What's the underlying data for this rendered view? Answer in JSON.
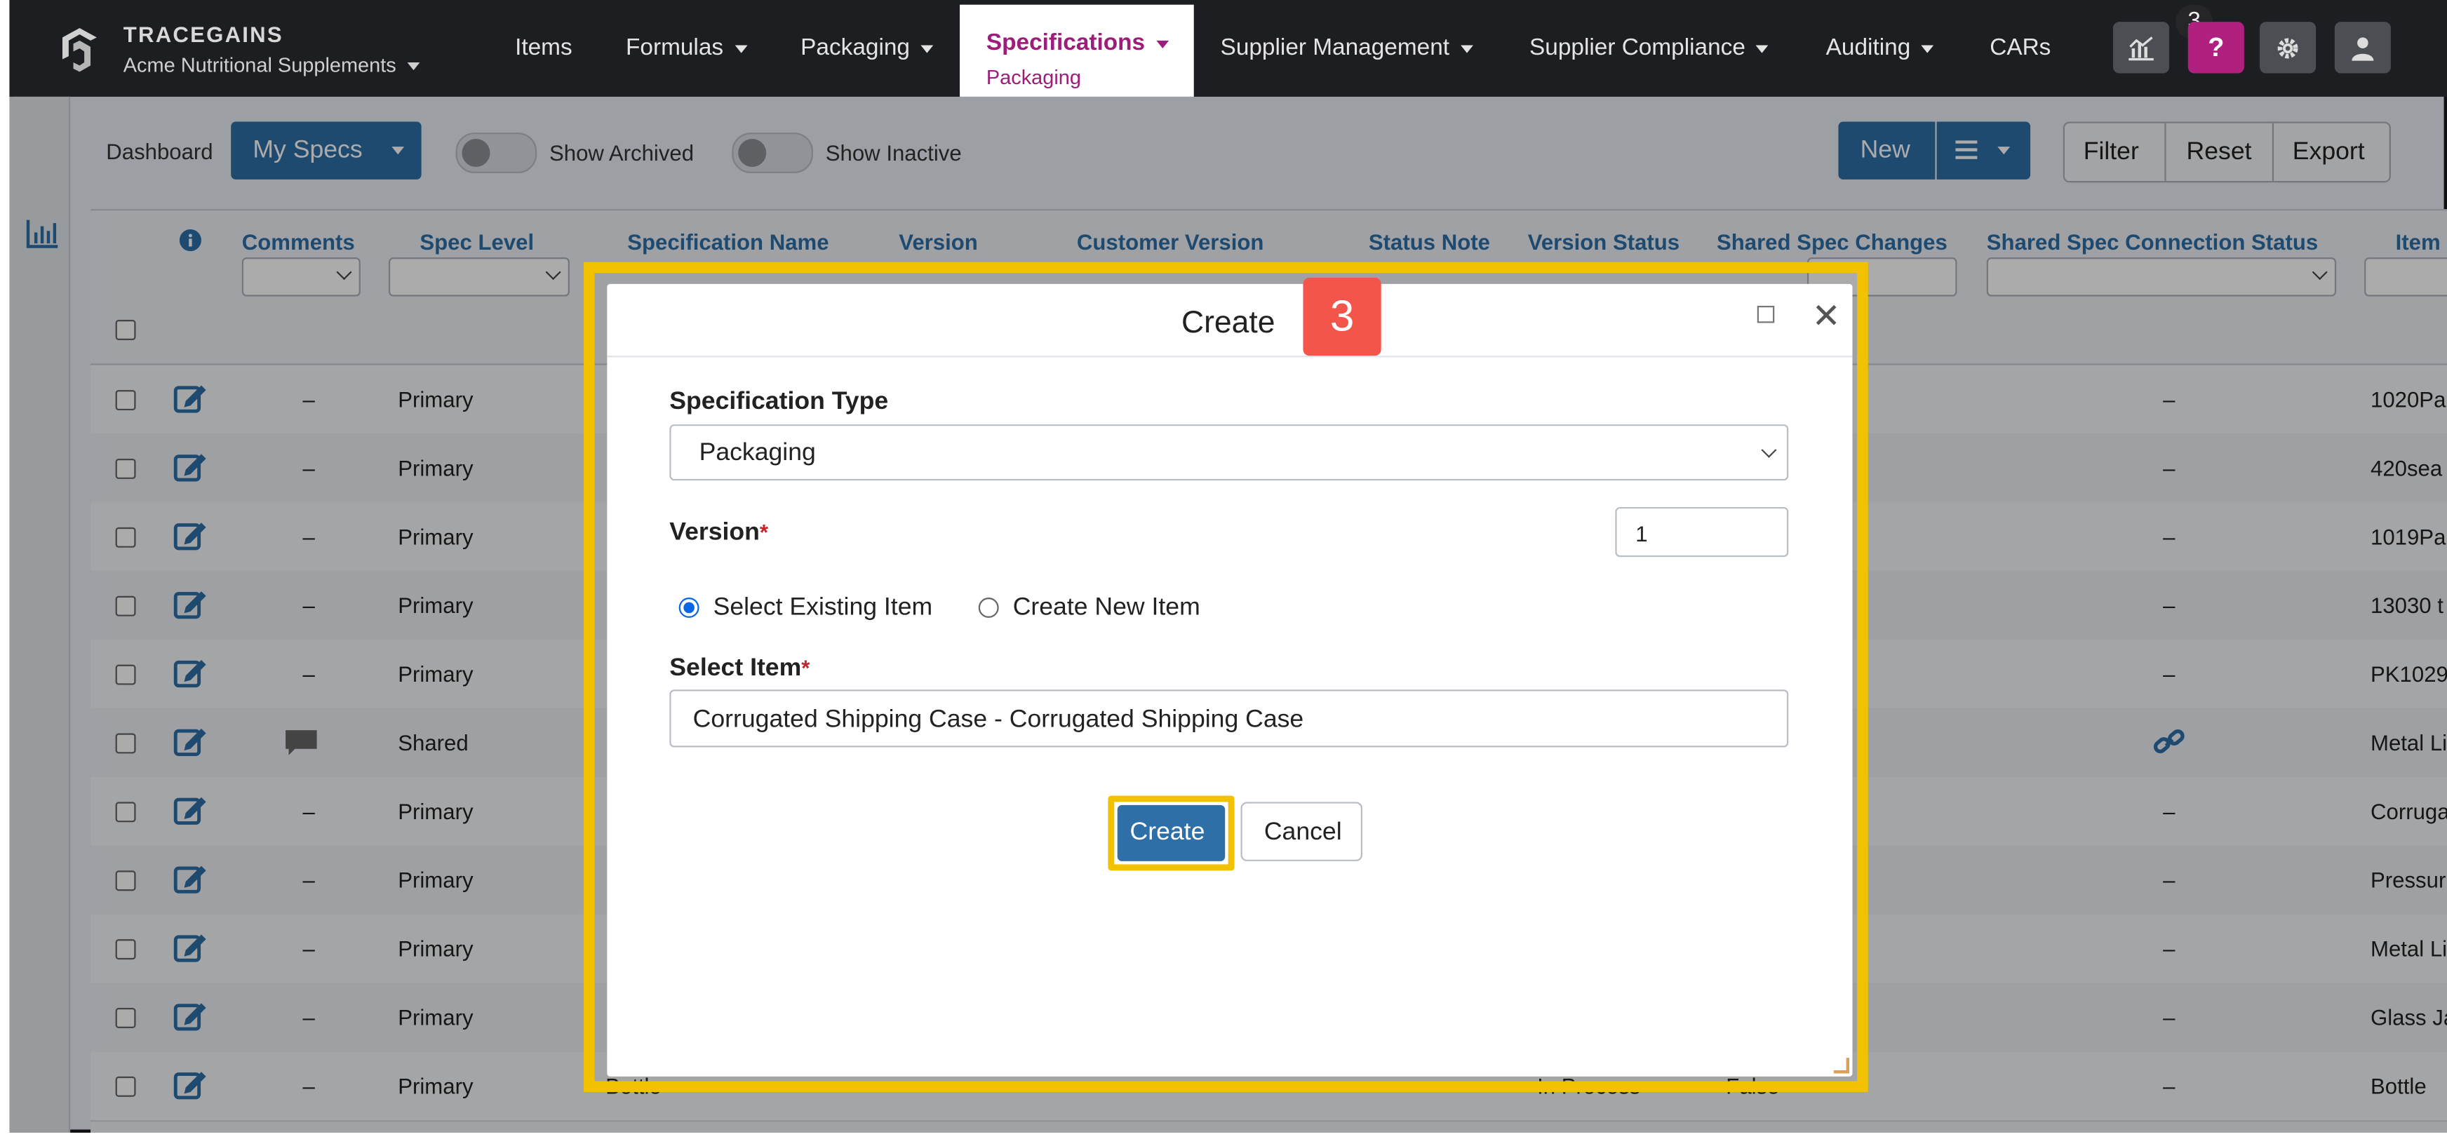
{
  "app": {
    "brand": "TRACEGAINS",
    "org": "Acme Nutritional Supplements",
    "nav": [
      {
        "label": "Items",
        "dropdown": false
      },
      {
        "label": "Formulas",
        "dropdown": true
      },
      {
        "label": "Packaging",
        "dropdown": true
      },
      {
        "label": "Supplier Management",
        "dropdown": true
      },
      {
        "label": "Supplier Compliance",
        "dropdown": true
      },
      {
        "label": "Auditing",
        "dropdown": true
      },
      {
        "label": "CARs",
        "dropdown": false
      }
    ],
    "active_nav": {
      "label": "Specifications",
      "sublabel": "Packaging"
    },
    "notif_count": "3",
    "help_label": "?",
    "icons": {
      "analytics": "chart-icon",
      "help": "question-icon",
      "settings": "gear-icon",
      "user": "user-icon"
    }
  },
  "toolbar": {
    "dashboard": "Dashboard",
    "my_specs": "My Specs",
    "show_archived": "Show Archived",
    "show_inactive": "Show Inactive",
    "new": "New",
    "filter": "Filter",
    "reset": "Reset",
    "export": "Export"
  },
  "table": {
    "headers": {
      "comments": "Comments",
      "spec_level": "Spec Level",
      "spec_name": "Specification Name",
      "version": "Version",
      "customer_version": "Customer Version",
      "status_note": "Status Note",
      "version_status": "Version Status",
      "shared_spec_changes": "Shared Spec Changes",
      "shared_spec_connection_status": "Shared Spec Connection Status",
      "item": "Item"
    },
    "rows": [
      {
        "comments": "–",
        "level": "Primary",
        "conn": "–",
        "item": "1020Pa"
      },
      {
        "comments": "–",
        "level": "Primary",
        "conn": "–",
        "item": "420sea"
      },
      {
        "comments": "–",
        "level": "Primary",
        "conn": "–",
        "item": "1019Pa"
      },
      {
        "comments": "–",
        "level": "Primary",
        "conn": "–",
        "item": "13030 t"
      },
      {
        "comments": "–",
        "level": "Primary",
        "conn": "–",
        "item": "PK1029"
      },
      {
        "comments": "",
        "level": "Shared",
        "conn": "",
        "item": "Metal Li"
      },
      {
        "comments": "–",
        "level": "Primary",
        "conn": "–",
        "item": "Corruga"
      },
      {
        "comments": "–",
        "level": "Primary",
        "conn": "–",
        "item": "Pressur"
      },
      {
        "comments": "–",
        "level": "Primary",
        "conn": "–",
        "item": "Metal Li"
      },
      {
        "comments": "–",
        "level": "Primary",
        "conn": "–",
        "item": "Glass Ja"
      },
      {
        "comments": "–",
        "level": "Primary",
        "conn": "–",
        "item": "Bottle"
      }
    ],
    "last_row_partial": {
      "spec_name": "Bottle",
      "version_status": "In Process",
      "shared_spec_changes": "False"
    }
  },
  "modal": {
    "title": "Create",
    "step": "3",
    "spec_type_label": "Specification Type",
    "spec_type_value": "Packaging",
    "version_label": "Version",
    "version_value": "1",
    "required_mark": "*",
    "radio_existing": "Select Existing Item",
    "radio_new": "Create New Item",
    "select_item_label": "Select Item",
    "select_item_value": "Corrugated Shipping Case - Corrugated Shipping Case",
    "create": "Create",
    "cancel": "Cancel"
  },
  "colors": {
    "navbar": "#1c1e21",
    "brand_magenta": "#9b1f7a",
    "primary_blue": "#2f6fa8",
    "highlight_yellow": "#f2c100",
    "step_badge": "#f4554a"
  }
}
